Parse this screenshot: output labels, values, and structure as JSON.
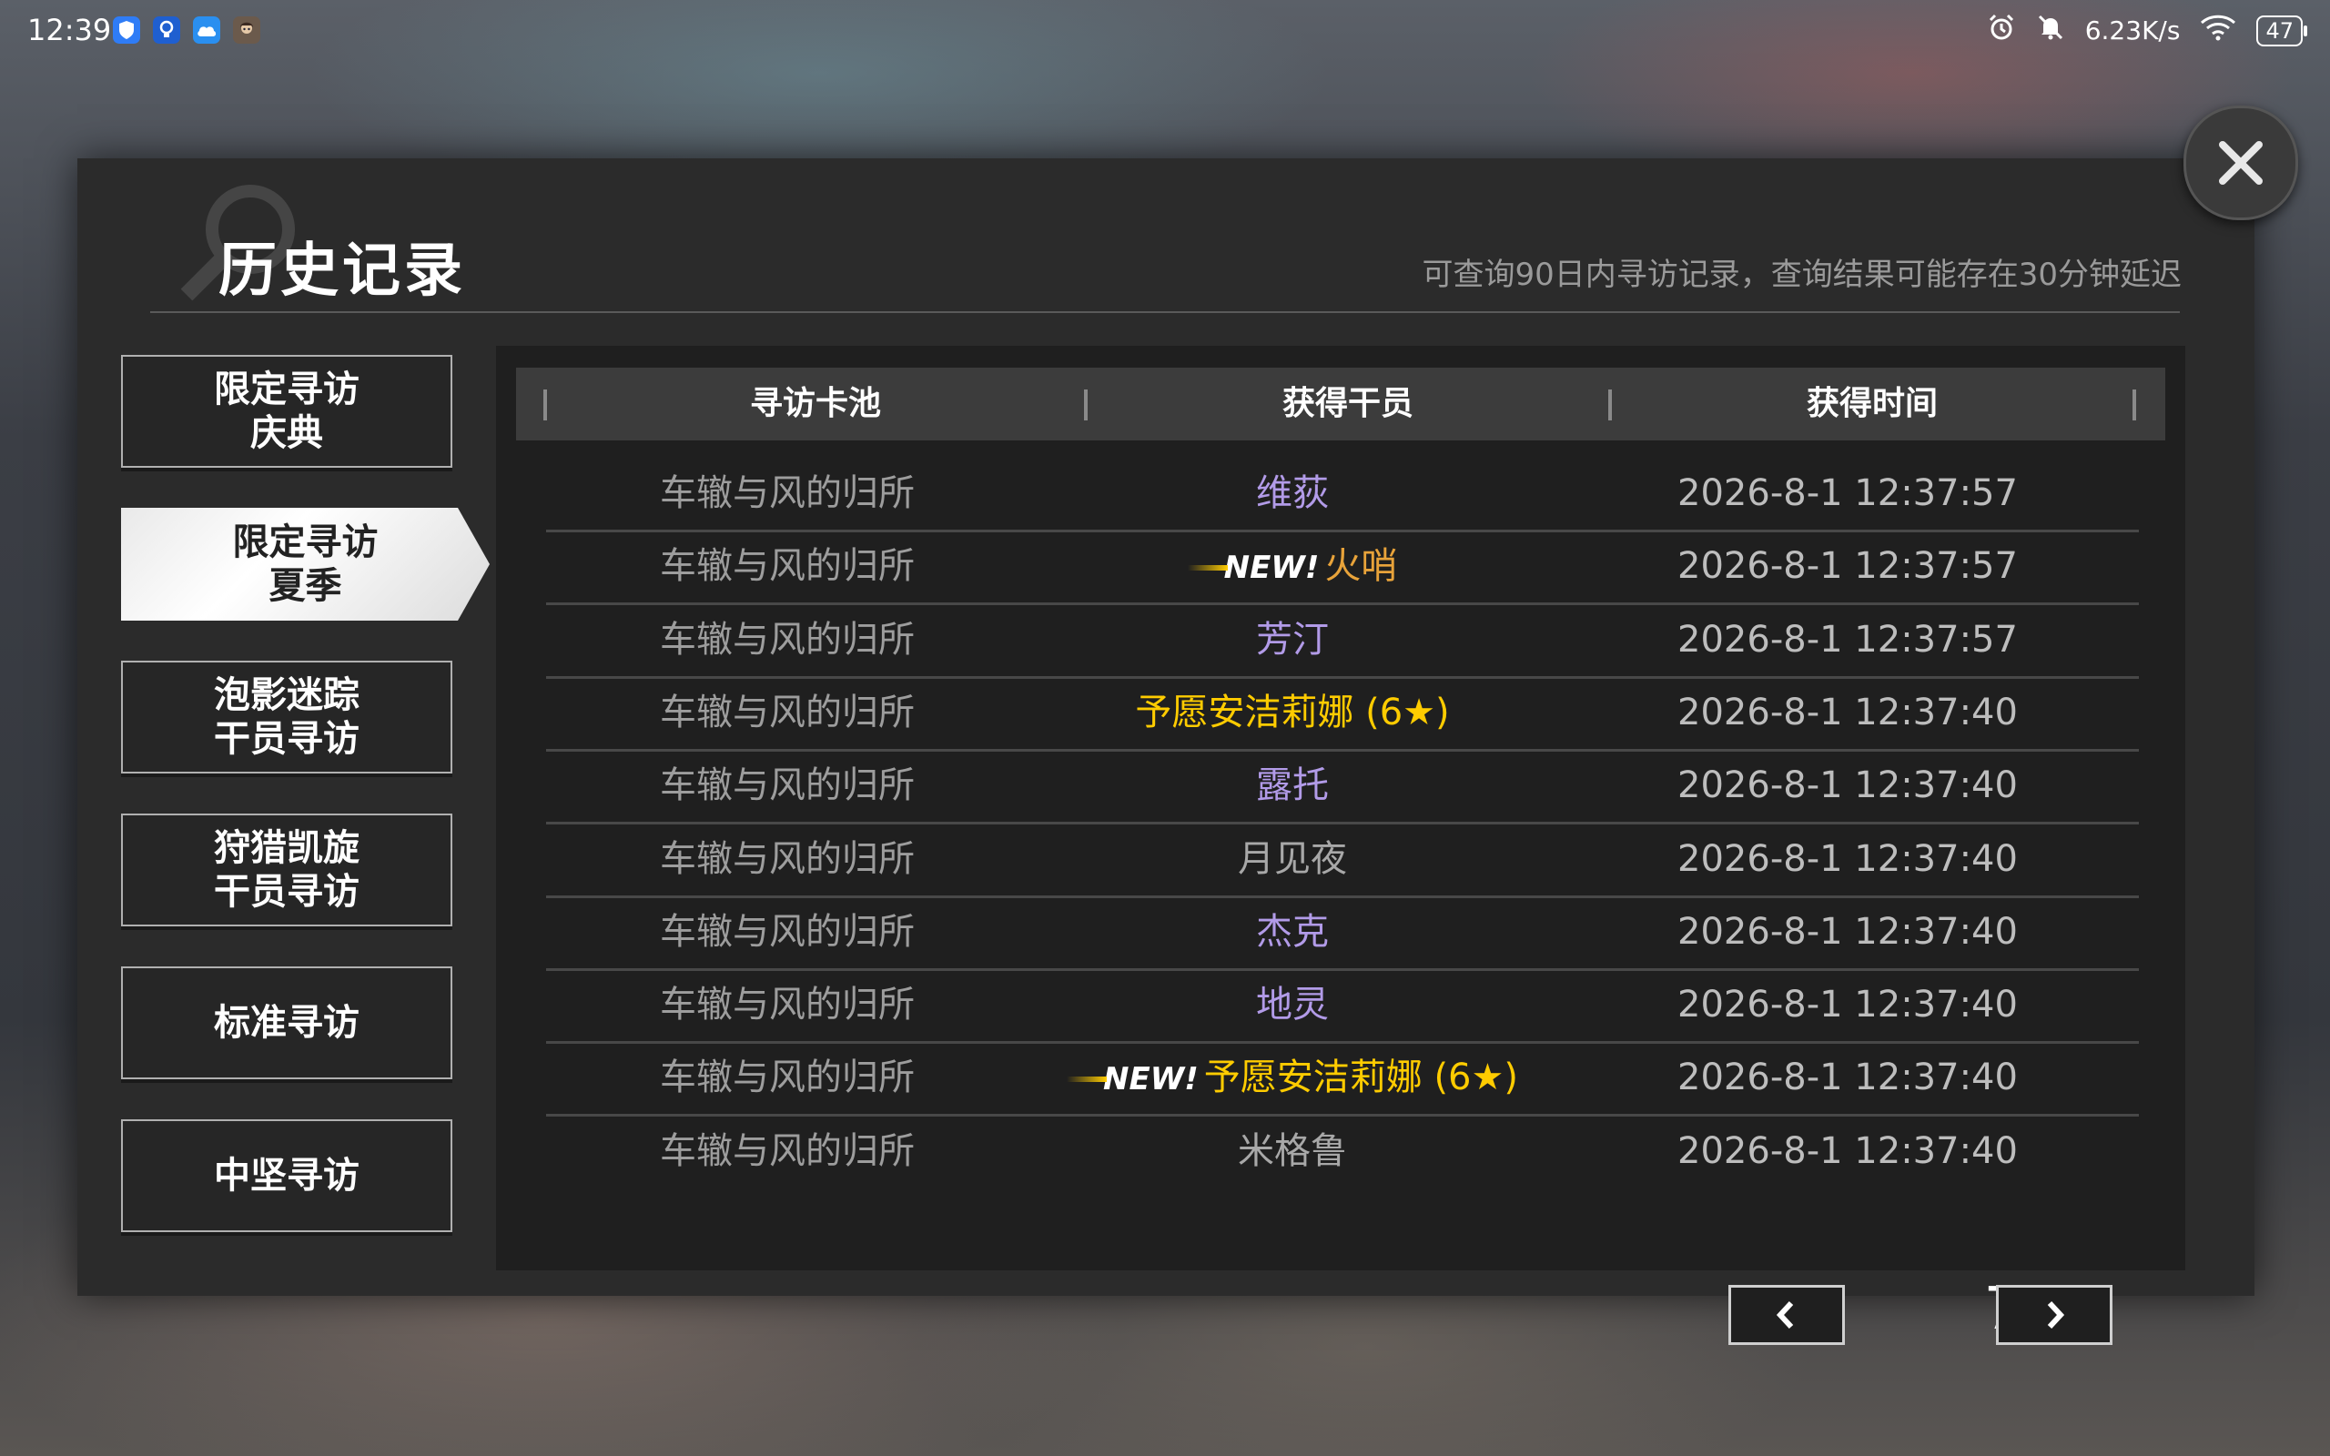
{
  "status_bar": {
    "time": "12:39",
    "net_speed": "6.23K/s",
    "battery": "47",
    "icons_left": [
      "shield-app-icon",
      "bulb-app-icon",
      "cloud-app-icon",
      "avatar-app-icon"
    ],
    "icons_right": [
      "alarm-icon",
      "mute-icon",
      "wifi-icon",
      "battery-icon"
    ]
  },
  "dialog": {
    "title": "历史记录",
    "subtitle": "可查询90日内寻访记录，查询结果可能存在30分钟延迟",
    "close_icon": "close-icon"
  },
  "sidebar": {
    "tabs": [
      {
        "line1": "限定寻访",
        "line2": "庆典",
        "active": false
      },
      {
        "line1": "限定寻访",
        "line2": "夏季",
        "active": true
      },
      {
        "line1": "泡影迷踪",
        "line2": "干员寻访",
        "active": false
      },
      {
        "line1": "狩猎凯旋",
        "line2": "干员寻访",
        "active": false
      },
      {
        "line1": "标准寻访",
        "line2": "",
        "active": false
      },
      {
        "line1": "中坚寻访",
        "line2": "",
        "active": false
      }
    ]
  },
  "table": {
    "headers": [
      "寻访卡池",
      "获得干员",
      "获得时间"
    ],
    "new_label": "NEW!",
    "rarity_colors": {
      "six_star": "#ffcc00",
      "five_star": "#e8a33a",
      "four_star": "#b29be8",
      "three_star": "#a8a8a8"
    },
    "rows": [
      {
        "pool": "车辙与风的归所",
        "operator": "维荻",
        "rarity": "four_star",
        "is_new": false,
        "time": "2026-8-1 12:37:57"
      },
      {
        "pool": "车辙与风的归所",
        "operator": "火哨",
        "rarity": "five_star",
        "is_new": true,
        "time": "2026-8-1 12:37:57"
      },
      {
        "pool": "车辙与风的归所",
        "operator": "芳汀",
        "rarity": "four_star",
        "is_new": false,
        "time": "2026-8-1 12:37:57"
      },
      {
        "pool": "车辙与风的归所",
        "operator": "予愿安洁莉娜 (6★)",
        "rarity": "six_star",
        "is_new": false,
        "time": "2026-8-1 12:37:40"
      },
      {
        "pool": "车辙与风的归所",
        "operator": "露托",
        "rarity": "four_star",
        "is_new": false,
        "time": "2026-8-1 12:37:40"
      },
      {
        "pool": "车辙与风的归所",
        "operator": "月见夜",
        "rarity": "three_star",
        "is_new": false,
        "time": "2026-8-1 12:37:40"
      },
      {
        "pool": "车辙与风的归所",
        "operator": "杰克",
        "rarity": "four_star",
        "is_new": false,
        "time": "2026-8-1 12:37:40"
      },
      {
        "pool": "车辙与风的归所",
        "operator": "地灵",
        "rarity": "four_star",
        "is_new": false,
        "time": "2026-8-1 12:37:40"
      },
      {
        "pool": "车辙与风的归所",
        "operator": "予愿安洁莉娜 (6★)",
        "rarity": "six_star",
        "is_new": true,
        "time": "2026-8-1 12:37:40"
      },
      {
        "pool": "车辙与风的归所",
        "operator": "米格鲁",
        "rarity": "three_star",
        "is_new": false,
        "time": "2026-8-1 12:37:40"
      }
    ]
  },
  "pager": {
    "page": "7",
    "prev_icon": "chevron-left-icon",
    "next_icon": "chevron-right-icon"
  }
}
